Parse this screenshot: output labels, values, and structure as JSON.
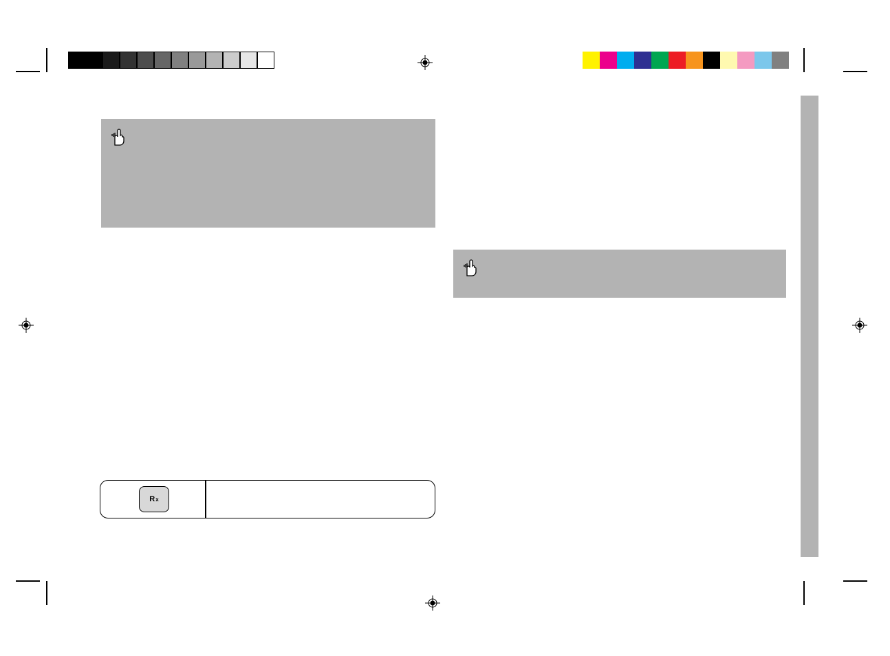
{
  "calibration": {
    "grayscale": [
      "#000000",
      "#000000",
      "#1a1a1a",
      "#333333",
      "#4d4d4d",
      "#666666",
      "#808080",
      "#999999",
      "#b3b3b3",
      "#cccccc",
      "#e6e6e6",
      "#ffffff"
    ],
    "colors": [
      "#fff200",
      "#ec008c",
      "#00adef",
      "#2e3092",
      "#00a651",
      "#ed1c24",
      "#f7941d",
      "#000000",
      "#fff9b0",
      "#f49ac1",
      "#7cc7eb",
      "#808080"
    ]
  },
  "key": {
    "label_main": "R",
    "label_sub": "x"
  }
}
